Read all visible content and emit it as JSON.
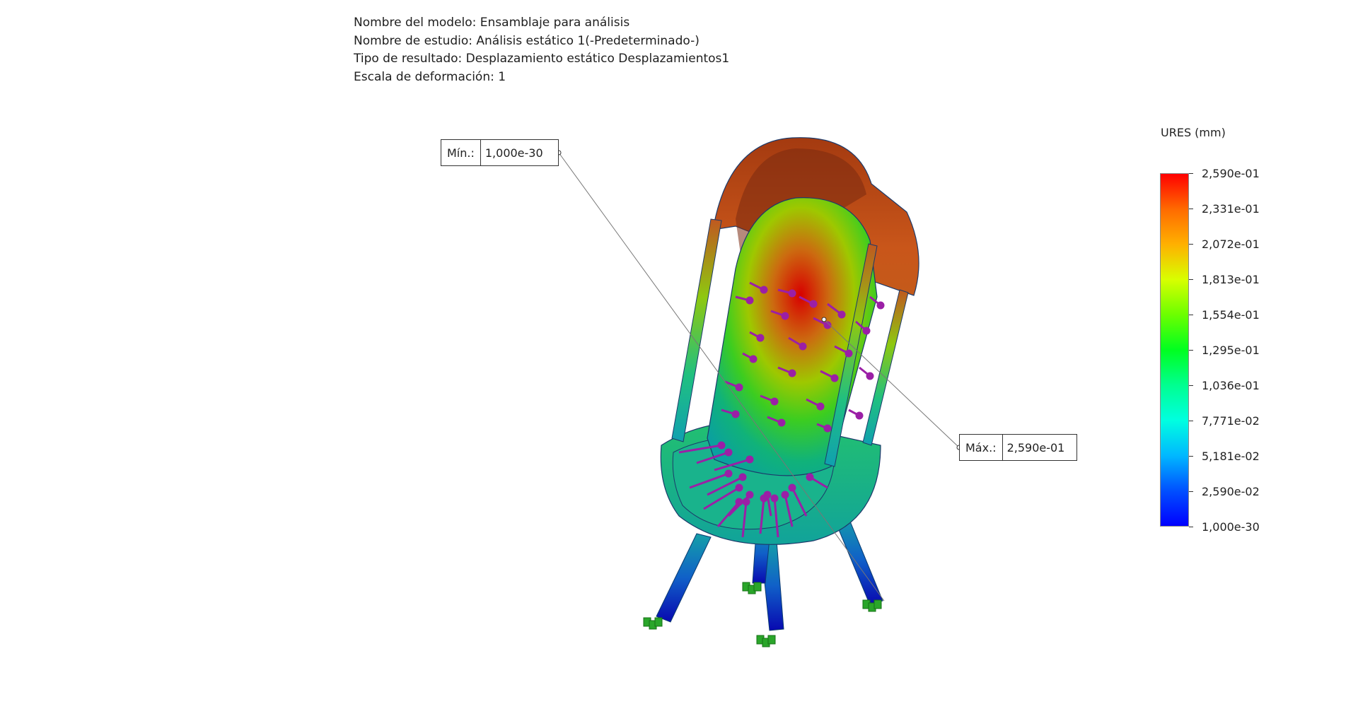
{
  "header": {
    "model_name": "Nombre del modelo: Ensamblaje para análisis",
    "study_name": "Nombre de estudio: Análisis estático 1(-Predeterminado-)",
    "result_type": "Tipo de resultado: Desplazamiento estático Desplazamientos1",
    "deformation_scale": "Escala de deformación: 1"
  },
  "callouts": {
    "min_label": "Mín.:",
    "min_value": "1,000e-30",
    "max_label": "Máx.:",
    "max_value": "2,590e-01"
  },
  "legend": {
    "title": "URES (mm)",
    "ticks": [
      "2,590e-01",
      "2,331e-01",
      "2,072e-01",
      "1,813e-01",
      "1,554e-01",
      "1,295e-01",
      "1,036e-01",
      "7,771e-02",
      "5,181e-02",
      "2,590e-02",
      "1,000e-30"
    ]
  },
  "colors": {
    "max": "#ff0000",
    "mid": "#00ff20",
    "min": "#0000ff",
    "load_arrows": "#9b1fa6",
    "fixtures": "#2aa62a"
  }
}
